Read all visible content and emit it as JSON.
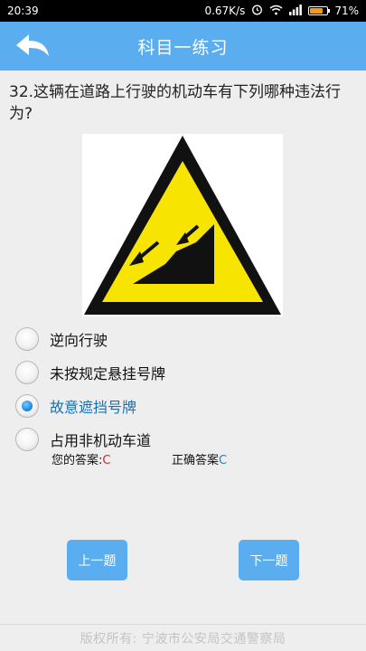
{
  "status": {
    "time": "20:39",
    "speed": "0.67K/s",
    "battery_pct": "71%",
    "battery_color": "#f39a1e"
  },
  "appbar": {
    "title": "科目一练习",
    "back_icon": "back-arrow-icon"
  },
  "question": {
    "text": "32.这辆在道路上行驶的机动车有下列哪种违法行为?"
  },
  "options": [
    {
      "label": "逆向行驶",
      "selected": false
    },
    {
      "label": "未按规定悬挂号牌",
      "selected": false
    },
    {
      "label": "故意遮挡号牌",
      "selected": true
    },
    {
      "label": "占用非机动车道",
      "selected": false
    }
  ],
  "answers": {
    "yours_label": "您的答案:",
    "yours_value": "C",
    "correct_label": "正确答案",
    "correct_value": "C"
  },
  "nav": {
    "prev_label": "上一题",
    "next_label": "下一题"
  },
  "footer": {
    "text": "版权所有:  宁波市公安局交通警察局"
  },
  "colors": {
    "accent": "#5aaef0",
    "sign_yellow": "#f7e400",
    "selected_text": "#1d6fae"
  }
}
